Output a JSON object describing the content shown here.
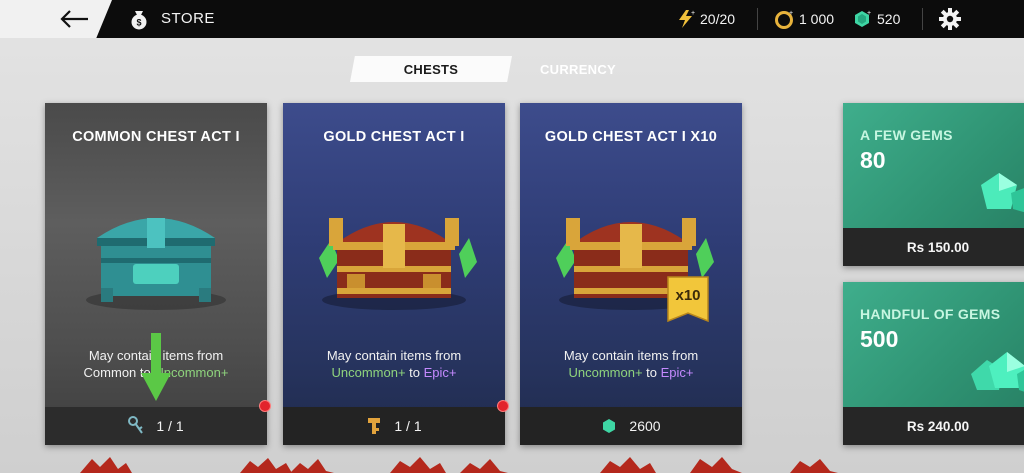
{
  "header": {
    "back_icon": "back-arrow-icon",
    "store_icon": "money-bag-icon",
    "title": "STORE",
    "energy": "20/20",
    "coins": "1 000",
    "gems": "520",
    "settings_icon": "gear-icon"
  },
  "tabs": [
    {
      "label": "CHESTS",
      "active": true
    },
    {
      "label": "CURRENCY",
      "active": false
    }
  ],
  "chests": [
    {
      "title": "COMMON CHEST ACT I",
      "desc_line1": "May contain items from",
      "desc_from": "Common",
      "desc_to": "Uncommon+",
      "desc_to_word": " to ",
      "cost_value": "1 / 1",
      "cost_icon": "common-key-icon"
    },
    {
      "title": "GOLD CHEST ACT I",
      "desc_line1": "May contain items from",
      "desc_from": "Uncommon+",
      "desc_to": "Epic+",
      "desc_to_word": " to ",
      "cost_value": "1 / 1",
      "cost_icon": "gold-key-icon"
    },
    {
      "title": "GOLD CHEST ACT I X10",
      "desc_line1": "May contain items from",
      "desc_from": "Uncommon+",
      "desc_to": "Epic+",
      "desc_to_word": " to ",
      "badge": "x10",
      "cost_value": "2600",
      "cost_icon": "gem-icon"
    }
  ],
  "gem_packs": [
    {
      "name": "A FEW GEMS",
      "amount": "80",
      "price": "Rs 150.00"
    },
    {
      "name": "HANDFUL OF GEMS",
      "amount": "500",
      "price": "Rs 240.00"
    }
  ],
  "colors": {
    "uncommon": "#8fd47d",
    "epic": "#c58aff",
    "gem": "#3ed6a4",
    "notification": "#e2242c"
  }
}
